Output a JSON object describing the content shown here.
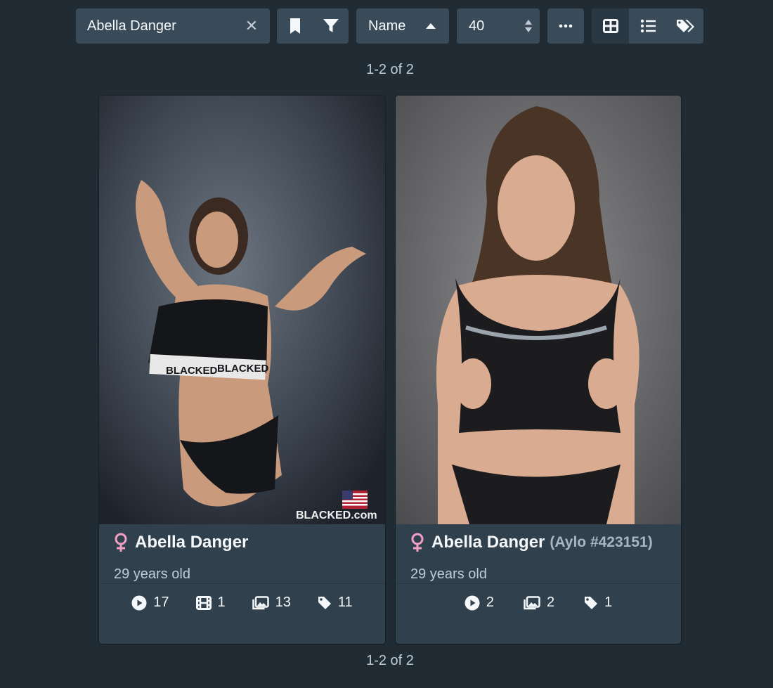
{
  "search": {
    "value": "Abella Danger",
    "clear_icon": "close-icon"
  },
  "sort": {
    "label": "Name",
    "direction_icon": "caret-up-icon"
  },
  "per_page": {
    "value": "40"
  },
  "result_count_top": "1-2 of 2",
  "result_count_bottom": "1-2 of 2",
  "colors": {
    "background": "#202b33",
    "card": "#30404d",
    "control": "#394b59",
    "female": "#f29fc5"
  },
  "performers": [
    {
      "name": "Abella Danger",
      "disambiguation": "",
      "age": "29 years old",
      "gender_icon": "female-icon",
      "flag_icon": "us-flag-icon",
      "watermark": "BLACKED.com",
      "stats": {
        "scenes": "17",
        "movies": "1",
        "images": "13",
        "tags": "11"
      }
    },
    {
      "name": "Abella Danger",
      "disambiguation": "(Aylo #423151)",
      "age": "29 years old",
      "gender_icon": "female-icon",
      "stats": {
        "scenes": "2",
        "images": "2",
        "tags": "1"
      }
    }
  ]
}
